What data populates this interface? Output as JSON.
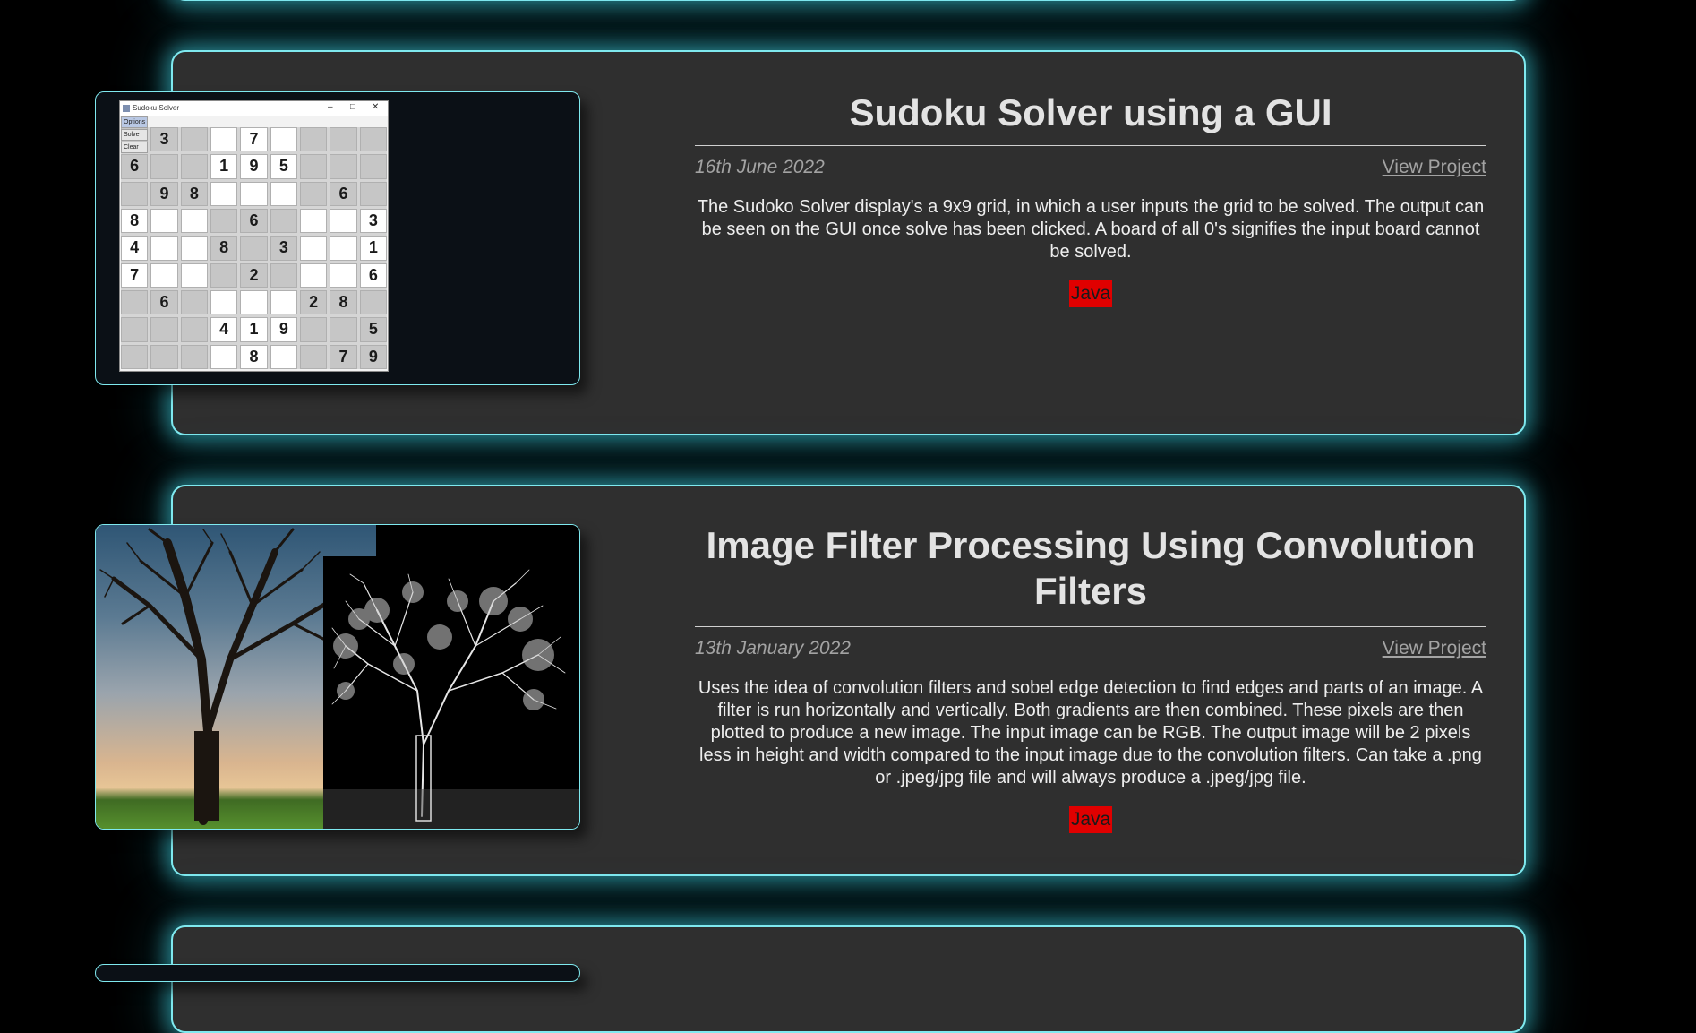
{
  "projects": [
    {
      "title": "Sudoku Solver using a GUI",
      "date": "16th June 2022",
      "link_label": "View Project",
      "description": "The Sudoko Solver display's a 9x9 grid, in which a user inputs the grid to be solved. The output can be seen on the GUI once solve has been clicked. A board of all 0's signifies the input board cannot be solved.",
      "tag": "Java",
      "screenshot": {
        "window_title": "Sudoku Solver",
        "menu": [
          "Options",
          "Solve",
          "Clear"
        ],
        "grid": [
          [
            "",
            "3",
            "",
            "",
            "7",
            "",
            "",
            "",
            ""
          ],
          [
            "6",
            "",
            "",
            "1",
            "9",
            "5",
            "",
            "",
            ""
          ],
          [
            "",
            "9",
            "8",
            "",
            "",
            "",
            "",
            "6",
            ""
          ],
          [
            "8",
            "",
            "",
            "",
            "6",
            "",
            "",
            "",
            "3"
          ],
          [
            "4",
            "",
            "",
            "8",
            "",
            "3",
            "",
            "",
            "1"
          ],
          [
            "7",
            "",
            "",
            "",
            "2",
            "",
            "",
            "",
            "6"
          ],
          [
            "",
            "6",
            "",
            "",
            "",
            "",
            "2",
            "8",
            ""
          ],
          [
            "",
            "",
            "",
            "4",
            "1",
            "9",
            "",
            "",
            "5"
          ],
          [
            "",
            "",
            "",
            "",
            "8",
            "",
            "",
            "7",
            "9"
          ]
        ]
      }
    },
    {
      "title": "Image Filter Processing Using Convolution Filters",
      "date": "13th January 2022",
      "link_label": "View Project",
      "description": "Uses the idea of convolution filters and sobel edge detection to find edges and parts of an image. A filter is run horizontally and vertically. Both gradients are then combined. These pixels are then plotted to produce a new image. The input image can be RGB. The output image will be 2 pixels less in height and width compared to the input image due to the convolution filters. Can take a .png or .jpeg/jpg file and will always produce a .jpeg/jpg file.",
      "tag": "Java"
    }
  ],
  "colors": {
    "page_background": "#000000",
    "card_background": "#2f2f2f",
    "card_border_glow": "#7fe9ef",
    "tag_background": "#e00000"
  }
}
